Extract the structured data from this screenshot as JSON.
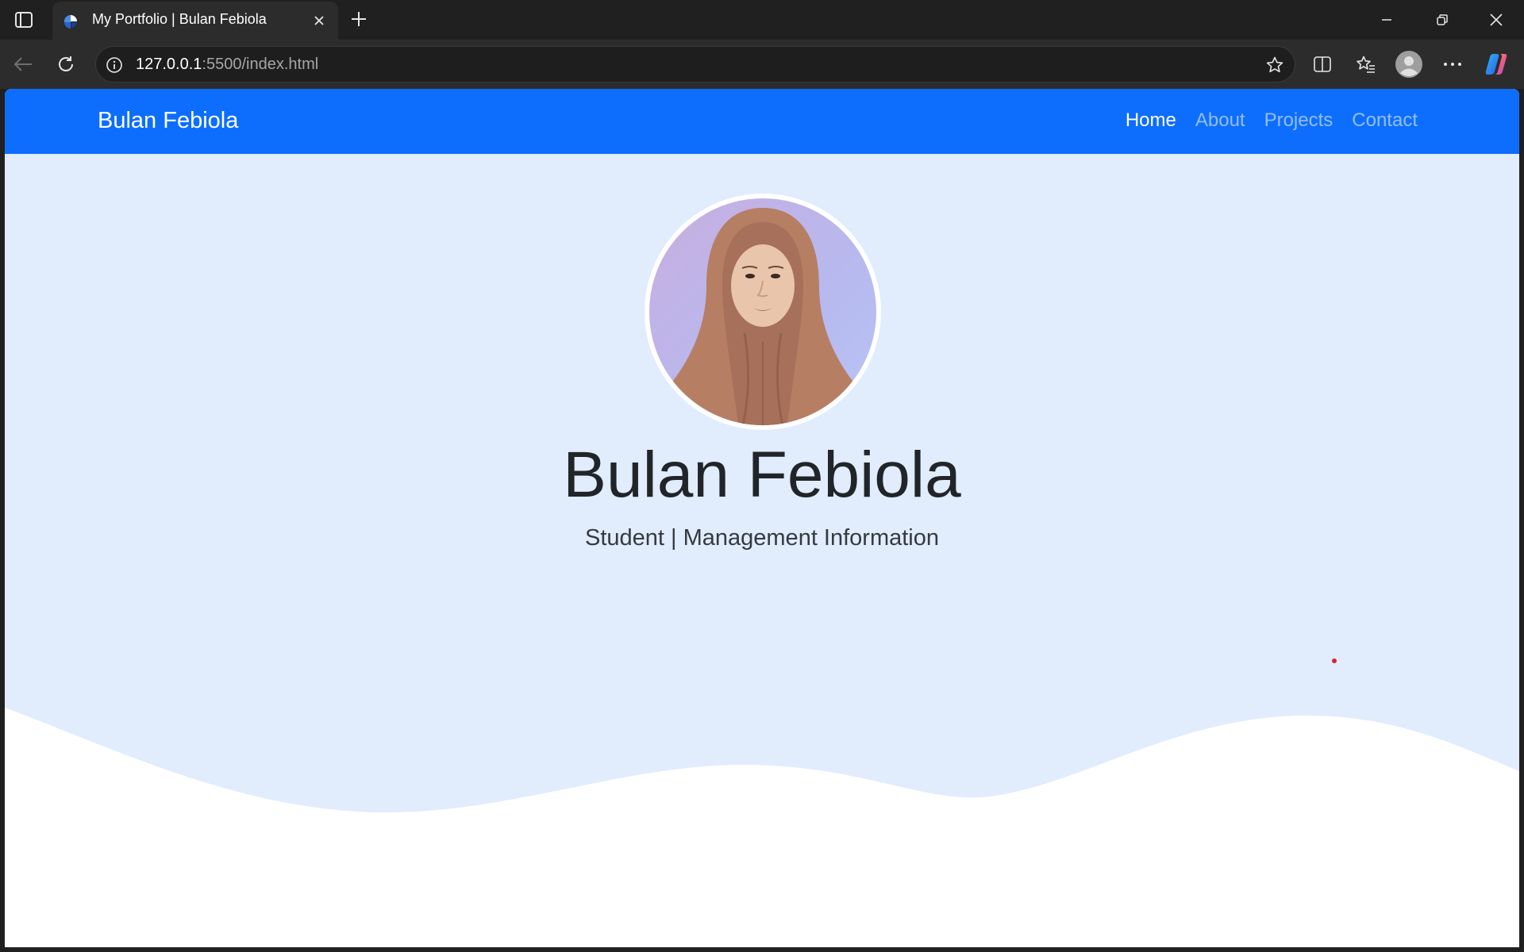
{
  "browser": {
    "tab_title": "My Portfolio | Bulan Febiola",
    "url_host": "127.0.0.1",
    "url_rest": ":5500/index.html"
  },
  "navbar": {
    "brand": "Bulan Febiola",
    "links": [
      "Home",
      "About",
      "Projects",
      "Contact"
    ],
    "active": "Home"
  },
  "hero": {
    "name": "Bulan Febiola",
    "subtitle": "Student | Management Information"
  },
  "colors": {
    "navbar_bg": "#0d6efd",
    "hero_bg": "#e1ecfd",
    "browser_chrome": "#202020"
  },
  "icons": {
    "tab_actions": "tab-actions-icon",
    "favicon": "favicon-icon",
    "close": "close-icon",
    "new_tab": "plus-icon",
    "back": "back-arrow-icon",
    "refresh": "refresh-icon",
    "info": "info-icon",
    "favorite": "star-icon",
    "split": "split-screen-icon",
    "favorites": "favorites-icon",
    "profile": "profile-icon",
    "menu": "more-icon",
    "copilot": "copilot-icon"
  }
}
